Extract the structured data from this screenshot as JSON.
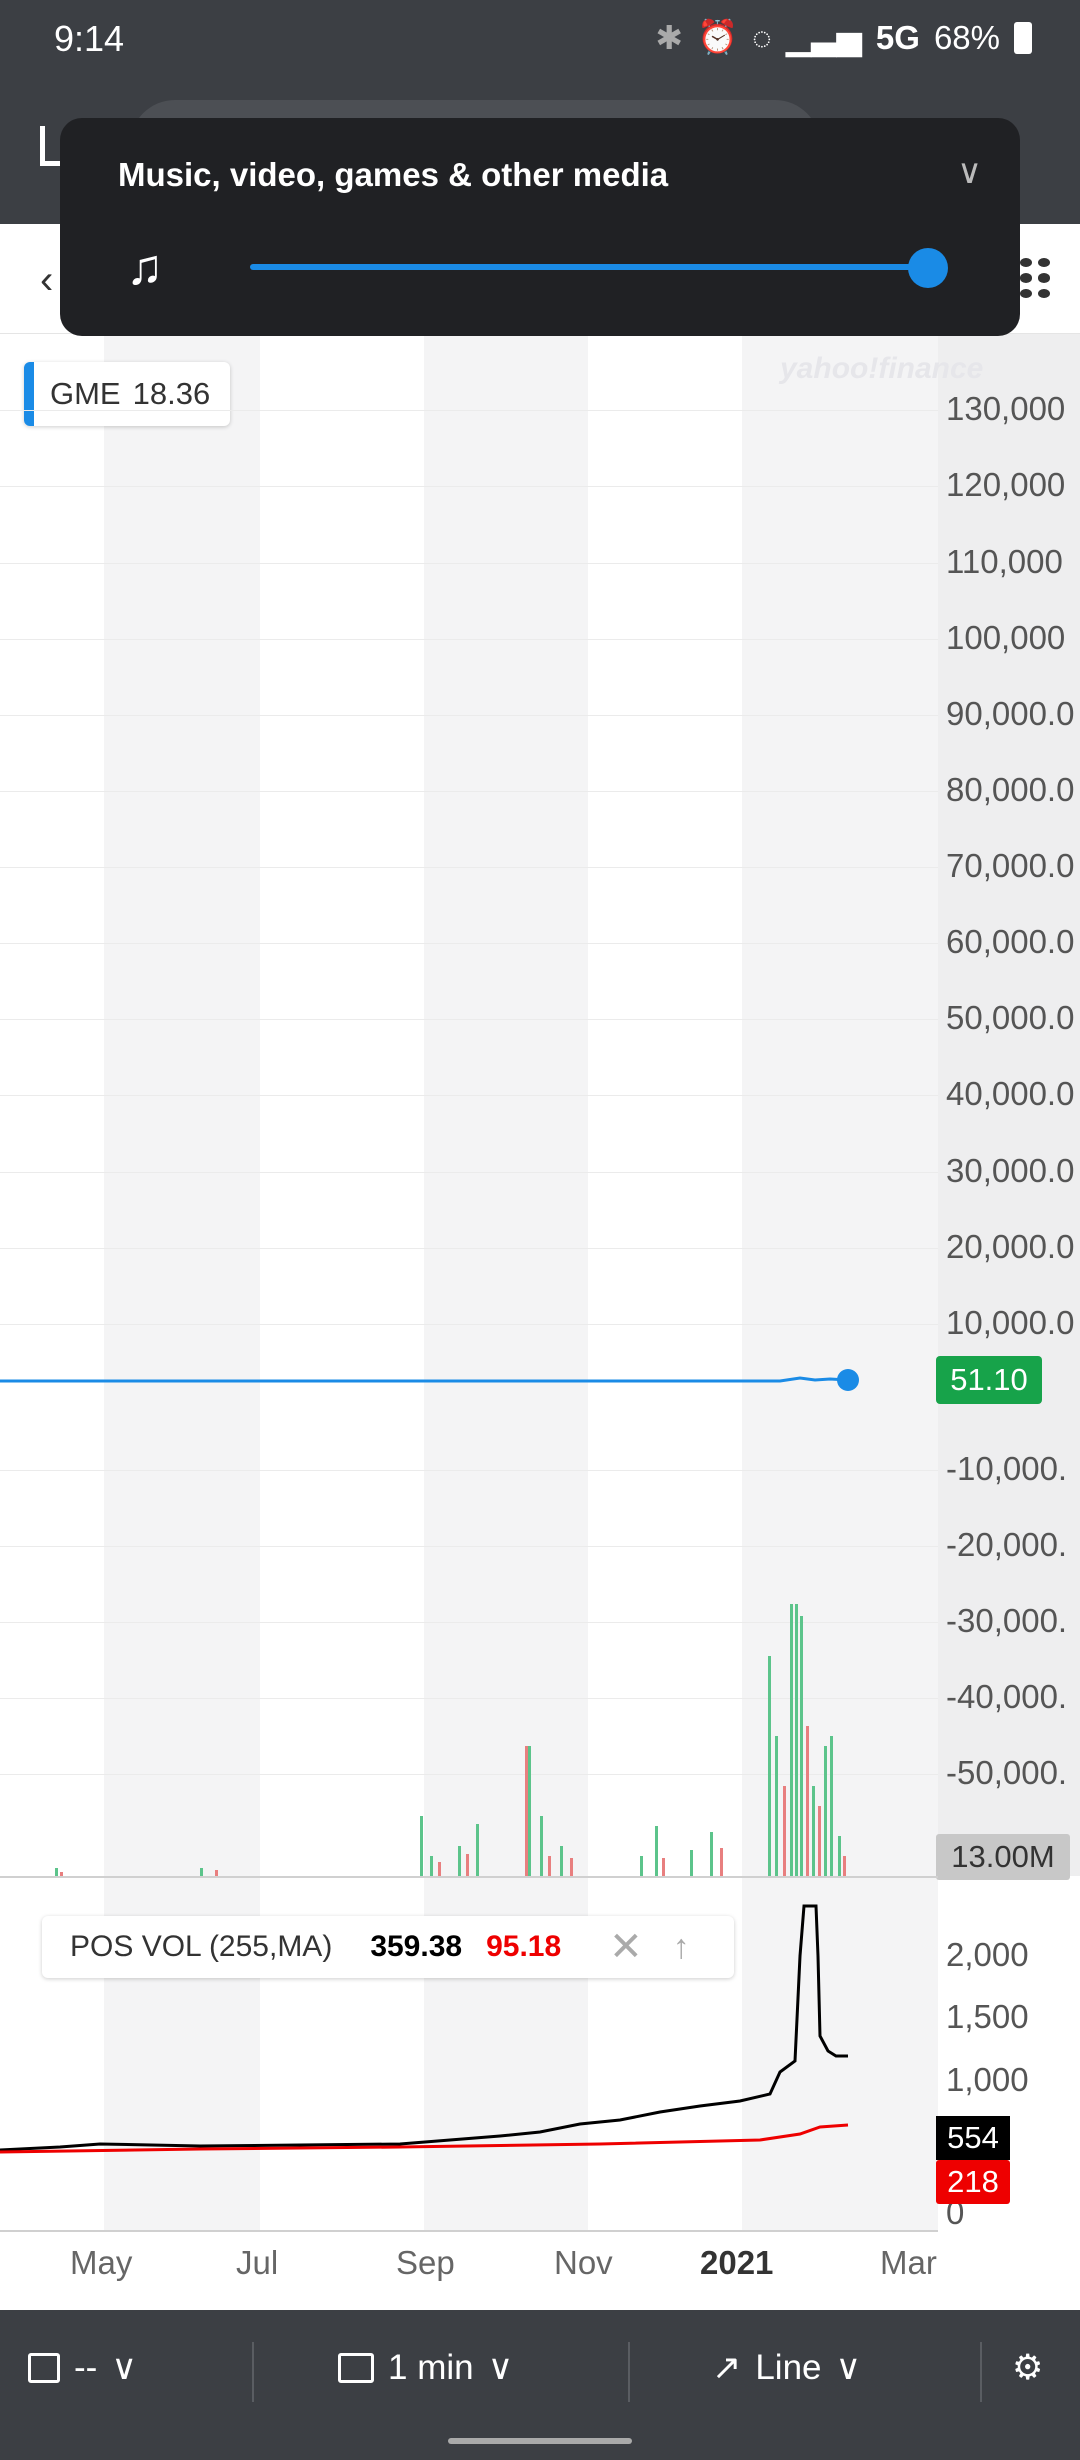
{
  "status_bar": {
    "time": "9:14",
    "network": "5G",
    "battery": "68%"
  },
  "media_panel": {
    "title": "Music, video, games & other media",
    "volume_level": 1.0
  },
  "chart": {
    "ticker_label": "GME",
    "ticker_value": "18.36",
    "watermark": "yahoo!finance",
    "current_price_tag": "51.10",
    "volume_tag": "13.00M",
    "y_axis_labels": [
      "130,000",
      "120,000",
      "110,000",
      "100,000",
      "90,000.0",
      "80,000.0",
      "70,000.0",
      "60,000.0",
      "50,000.0",
      "40,000.0",
      "30,000.0",
      "20,000.0",
      "10,000.0",
      "-10,000.",
      "-20,000.",
      "-30,000.",
      "-40,000.",
      "-50,000."
    ],
    "x_axis_labels": [
      "May",
      "Jul",
      "Sep",
      "Nov",
      "2021",
      "Mar"
    ],
    "lower_panel": {
      "indicator_label": "POS VOL (255,MA)",
      "value_black": "359.38",
      "value_red": "95.18",
      "y_labels": [
        "2,000",
        "1,500",
        "1,000",
        "0"
      ],
      "tag_black": "554",
      "tag_red": "218"
    }
  },
  "bottom_bar": {
    "date_value": "--",
    "interval": "1 min",
    "chart_type": "Line"
  }
}
